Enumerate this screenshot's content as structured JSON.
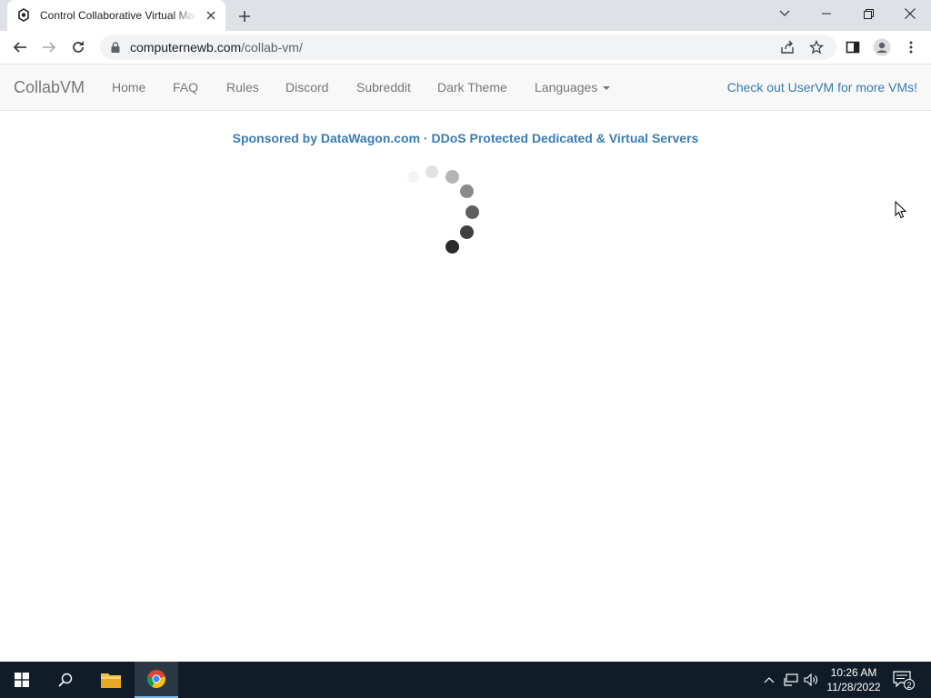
{
  "browser": {
    "tab_title": "Control Collaborative Virtual Machines!",
    "url_host": "computernewb.com",
    "url_path": "/collab-vm/"
  },
  "navbar": {
    "brand": "CollabVM",
    "links": [
      "Home",
      "FAQ",
      "Rules",
      "Discord",
      "Subreddit",
      "Dark Theme",
      "Languages"
    ],
    "right_link": "Check out UserVM for more VMs!"
  },
  "sponsor": "Sponsored by DataWagon.com · DDoS Protected Dedicated & Virtual Servers",
  "taskbar": {
    "time": "10:26 AM",
    "date": "11/28/2022",
    "notification_count": "2"
  },
  "colors": {
    "link": "#337ab7",
    "sponsor": "#3a7cb5",
    "navbar_bg": "#f8f8f8",
    "taskbar_bg": "#101c28"
  }
}
